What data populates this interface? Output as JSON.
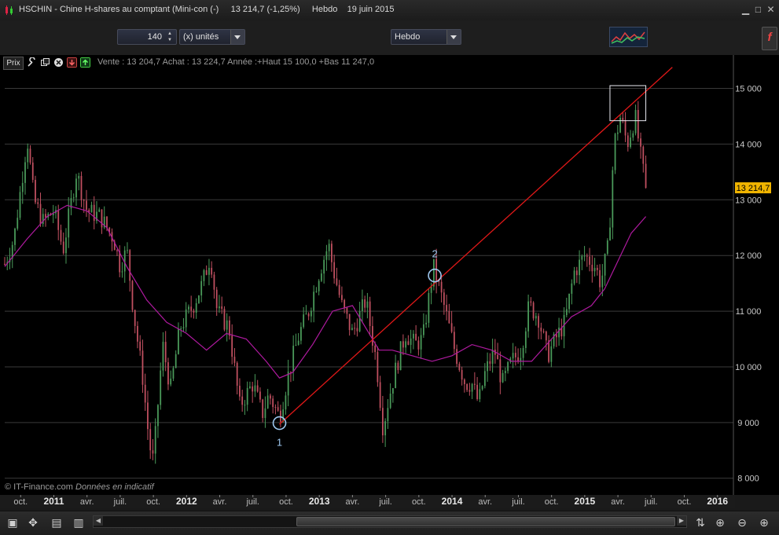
{
  "window": {
    "title": "HSCHIN - Chine H-shares au comptant (Mini-con (-)",
    "last": "13 214,7 (-1,25%)",
    "period": "Hebdo",
    "date": "19 juin 2015"
  },
  "toolbar": {
    "units_value": "140",
    "units_label": "(x) unités",
    "period_select": "Hebdo"
  },
  "infobar": {
    "prix_label": "Prix",
    "text": "Vente : 13 204,7 Achat : 13 224,7 Année :+Haut 15 100,0 +Bas 11 247,0"
  },
  "footer": {
    "copyright": "© IT-Finance.com",
    "note": "Données en indicatif"
  },
  "colors": {
    "background": "#000000",
    "grid": "#3a3a3a",
    "candle_up": "#4a9a5a",
    "candle_down": "#c05060",
    "ma": "#b01aa0",
    "trendline": "#e01818",
    "marker": "#9ec8f0",
    "price_label_bg": "#f0b400"
  },
  "chart_data": {
    "type": "candlestick",
    "price_label": "13 214,7",
    "y_ticks": [
      "15 000",
      "14 000",
      "13 000",
      "12 000",
      "11 000",
      "10 000",
      "9 000",
      "8 000"
    ],
    "y_tick_values": [
      15000,
      14000,
      13000,
      12000,
      11000,
      10000,
      9000,
      8000
    ],
    "ylim": [
      7700,
      15600
    ],
    "x_ticks": [
      {
        "label": "oct.",
        "t": -0.25,
        "bold": false
      },
      {
        "label": "2011",
        "t": 0.0,
        "bold": true
      },
      {
        "label": "avr.",
        "t": 0.25,
        "bold": false
      },
      {
        "label": "juil.",
        "t": 0.5,
        "bold": false
      },
      {
        "label": "oct.",
        "t": 0.75,
        "bold": false
      },
      {
        "label": "2012",
        "t": 1.0,
        "bold": true
      },
      {
        "label": "avr.",
        "t": 1.25,
        "bold": false
      },
      {
        "label": "juil.",
        "t": 1.5,
        "bold": false
      },
      {
        "label": "oct.",
        "t": 1.75,
        "bold": false
      },
      {
        "label": "2013",
        "t": 2.0,
        "bold": true
      },
      {
        "label": "avr.",
        "t": 2.25,
        "bold": false
      },
      {
        "label": "juil.",
        "t": 2.5,
        "bold": false
      },
      {
        "label": "oct.",
        "t": 2.75,
        "bold": false
      },
      {
        "label": "2014",
        "t": 3.0,
        "bold": true
      },
      {
        "label": "avr.",
        "t": 3.25,
        "bold": false
      },
      {
        "label": "juil.",
        "t": 3.5,
        "bold": false
      },
      {
        "label": "oct.",
        "t": 3.75,
        "bold": false
      },
      {
        "label": "2015",
        "t": 4.0,
        "bold": true
      },
      {
        "label": "avr.",
        "t": 4.25,
        "bold": false
      },
      {
        "label": "juil.",
        "t": 4.5,
        "bold": false
      },
      {
        "label": "oct.",
        "t": 4.75,
        "bold": false
      },
      {
        "label": "2016",
        "t": 5.0,
        "bold": true
      }
    ],
    "xlim": [
      -0.37,
      5.12
    ],
    "series_path": [
      [
        -0.37,
        11850
      ],
      [
        -0.3,
        12300
      ],
      [
        -0.2,
        14100
      ],
      [
        -0.15,
        13000
      ],
      [
        -0.08,
        12600
      ],
      [
        0.0,
        12800
      ],
      [
        0.07,
        12100
      ],
      [
        0.17,
        13500
      ],
      [
        0.25,
        12800
      ],
      [
        0.35,
        12700
      ],
      [
        0.45,
        12300
      ],
      [
        0.5,
        11800
      ],
      [
        0.55,
        12100
      ],
      [
        0.6,
        11000
      ],
      [
        0.67,
        9800
      ],
      [
        0.72,
        8600
      ],
      [
        0.75,
        8300
      ],
      [
        0.82,
        10400
      ],
      [
        0.88,
        9600
      ],
      [
        0.95,
        10700
      ],
      [
        1.05,
        11100
      ],
      [
        1.12,
        11500
      ],
      [
        1.18,
        12000
      ],
      [
        1.23,
        11000
      ],
      [
        1.32,
        10700
      ],
      [
        1.4,
        9300
      ],
      [
        1.5,
        9700
      ],
      [
        1.57,
        9150
      ],
      [
        1.62,
        9500
      ],
      [
        1.7,
        9100
      ],
      [
        1.77,
        9900
      ],
      [
        1.85,
        10600
      ],
      [
        1.92,
        11000
      ],
      [
        2.0,
        11700
      ],
      [
        2.07,
        12200
      ],
      [
        2.1,
        11800
      ],
      [
        2.17,
        11100
      ],
      [
        2.25,
        10600
      ],
      [
        2.3,
        10900
      ],
      [
        2.35,
        11200
      ],
      [
        2.43,
        10100
      ],
      [
        2.48,
        8900
      ],
      [
        2.52,
        9400
      ],
      [
        2.58,
        10000
      ],
      [
        2.65,
        10600
      ],
      [
        2.72,
        10400
      ],
      [
        2.78,
        10500
      ],
      [
        2.86,
        11800
      ],
      [
        2.95,
        11000
      ],
      [
        3.02,
        10300
      ],
      [
        3.1,
        9700
      ],
      [
        3.15,
        9700
      ],
      [
        3.2,
        9350
      ],
      [
        3.25,
        9900
      ],
      [
        3.32,
        10300
      ],
      [
        3.38,
        9700
      ],
      [
        3.45,
        10100
      ],
      [
        3.52,
        10300
      ],
      [
        3.58,
        11100
      ],
      [
        3.65,
        10900
      ],
      [
        3.72,
        10200
      ],
      [
        3.78,
        10500
      ],
      [
        3.85,
        10800
      ],
      [
        3.92,
        11700
      ],
      [
        4.0,
        12000
      ],
      [
        4.08,
        11800
      ],
      [
        4.12,
        11500
      ],
      [
        4.18,
        12200
      ],
      [
        4.22,
        14000
      ],
      [
        4.27,
        14500
      ],
      [
        4.32,
        14000
      ],
      [
        4.38,
        14500
      ],
      [
        4.42,
        13800
      ],
      [
        4.46,
        13215
      ]
    ],
    "moving_average": [
      [
        -0.37,
        11800
      ],
      [
        -0.2,
        12300
      ],
      [
        -0.05,
        12700
      ],
      [
        0.1,
        12900
      ],
      [
        0.25,
        12800
      ],
      [
        0.4,
        12500
      ],
      [
        0.55,
        11800
      ],
      [
        0.7,
        11200
      ],
      [
        0.85,
        10800
      ],
      [
        1.0,
        10600
      ],
      [
        1.15,
        10300
      ],
      [
        1.3,
        10600
      ],
      [
        1.45,
        10500
      ],
      [
        1.6,
        10100
      ],
      [
        1.7,
        9800
      ],
      [
        1.8,
        9900
      ],
      [
        1.95,
        10400
      ],
      [
        2.1,
        11000
      ],
      [
        2.25,
        11100
      ],
      [
        2.35,
        10700
      ],
      [
        2.45,
        10300
      ],
      [
        2.55,
        10300
      ],
      [
        2.7,
        10200
      ],
      [
        2.85,
        10100
      ],
      [
        3.0,
        10200
      ],
      [
        3.15,
        10400
      ],
      [
        3.3,
        10300
      ],
      [
        3.45,
        10100
      ],
      [
        3.6,
        10100
      ],
      [
        3.75,
        10500
      ],
      [
        3.9,
        10900
      ],
      [
        4.05,
        11100
      ],
      [
        4.15,
        11400
      ],
      [
        4.25,
        11900
      ],
      [
        4.35,
        12400
      ],
      [
        4.46,
        12700
      ]
    ],
    "trendline": [
      [
        1.7,
        8970
      ],
      [
        4.66,
        15380
      ]
    ],
    "markers": [
      {
        "label": "1",
        "t": 1.7,
        "v": 8990
      },
      {
        "label": "2",
        "t": 2.87,
        "v": 11640
      }
    ],
    "highlight_box": {
      "t0": 4.19,
      "t1": 4.46,
      "v0": 14420,
      "v1": 15050
    },
    "grid": true,
    "legend": "none"
  }
}
